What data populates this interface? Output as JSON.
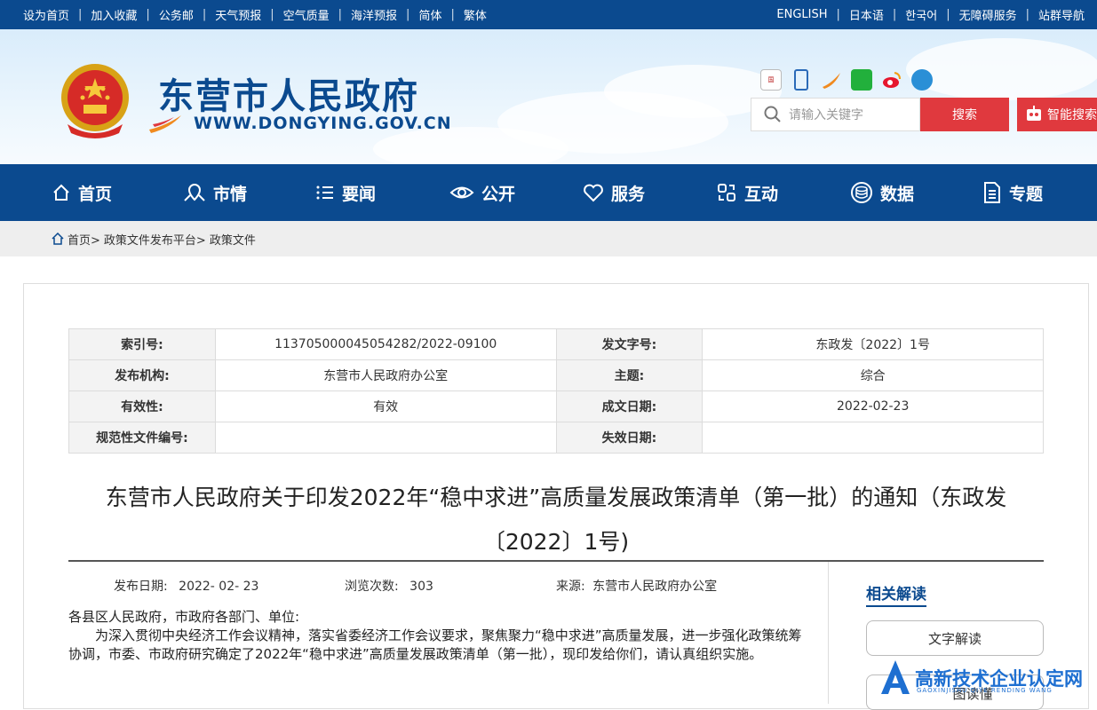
{
  "topbar": {
    "left_links": [
      "设为首页",
      "加入收藏",
      "公务邮",
      "天气预报",
      "空气质量",
      "海洋预报",
      "简体",
      "繁体"
    ],
    "right_links": [
      "ENGLISH",
      "日本语",
      "한국어",
      "无障碍服务",
      "站群导航"
    ]
  },
  "header": {
    "title": "东营市人民政府",
    "url": "WWW.DONGYING.GOV.CN",
    "social_icons": [
      "state-council-app-icon",
      "mobile-icon",
      "swoosh-app-icon",
      "wechat-icon",
      "weibo-icon",
      "robot-icon"
    ]
  },
  "search": {
    "placeholder": "请输入关键字",
    "button": "搜索",
    "smart_button": "智能搜索"
  },
  "nav": {
    "items": [
      {
        "label": "首页",
        "icon": "home-icon"
      },
      {
        "label": "市情",
        "icon": "map-pin-icon"
      },
      {
        "label": "要闻",
        "icon": "list-icon"
      },
      {
        "label": "公开",
        "icon": "eye-icon"
      },
      {
        "label": "服务",
        "icon": "heart-icon"
      },
      {
        "label": "互动",
        "icon": "interact-icon"
      },
      {
        "label": "数据",
        "icon": "database-icon"
      },
      {
        "label": "专题",
        "icon": "document-icon"
      }
    ]
  },
  "breadcrumb": {
    "home": "首页>",
    "platform": "政策文件发布平台>",
    "current": "政策文件"
  },
  "meta": {
    "rows": [
      {
        "k1": "索引号:",
        "v1": "113705000045054282/2022-09100",
        "k2": "发文字号:",
        "v2": "东政发〔2022〕1号"
      },
      {
        "k1": "发布机构:",
        "v1": "东营市人民政府办公室",
        "k2": "主题:",
        "v2": "综合"
      },
      {
        "k1": "有效性:",
        "v1": "有效",
        "k2": "成文日期:",
        "v2": "2022-02-23"
      },
      {
        "k1": "规范性文件编号:",
        "v1": "",
        "k2": "失效日期:",
        "v2": ""
      }
    ]
  },
  "document": {
    "title_line1": "东营市人民政府关于印发2022年“稳中求进”高质量发展政策清单（第一批）的通知（东政发",
    "title_line2": "〔2022〕1号)",
    "publish_date_label": "发布日期:",
    "publish_date": "2022- 02- 23",
    "views_label": "浏览次数:",
    "views": "303",
    "source_label": "来源:",
    "source": "东营市人民政府办公室",
    "salutation": "各县区人民政府，市政府各部门、单位:",
    "paragraph": "为深入贯彻中央经济工作会议精神，落实省委经济工作会议要求，聚焦聚力“稳中求进”高质量发展，进一步强化政策统筹协调，市委、市政府研究确定了2022年“稳中求进”高质量发展政策清单（第一批），现印发给你们，请认真组织实施。"
  },
  "related": {
    "title": "相关解读",
    "buttons": [
      "文字解读",
      "图读懂"
    ]
  },
  "watermark": {
    "text": "高新技术企业认定网",
    "sub": "GAOXINJISHU QIYE RENDING WANG"
  },
  "colors": {
    "primary": "#0b4a8f",
    "accent": "#e0393e",
    "watermark": "#1e6fd1"
  }
}
